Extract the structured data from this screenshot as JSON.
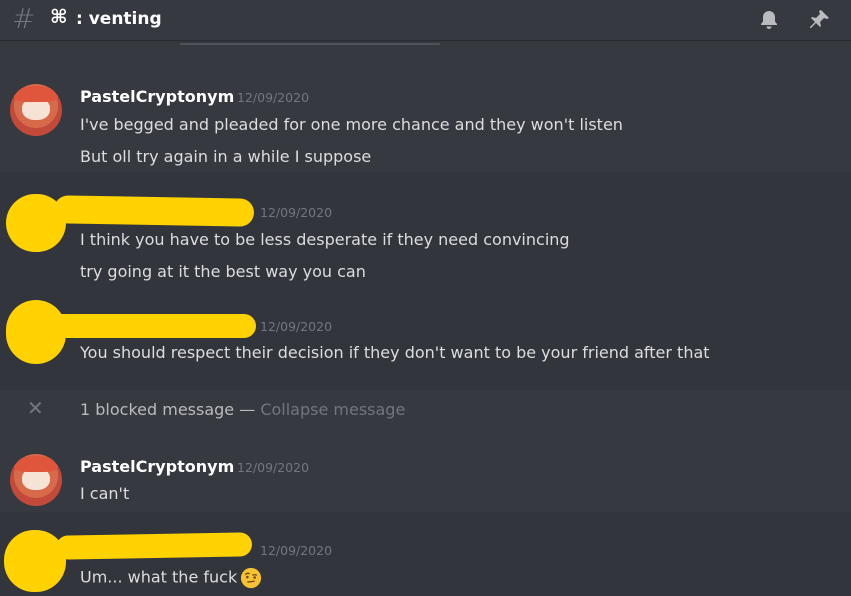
{
  "header": {
    "channel_prefix": "#",
    "channel_emoji": "⌘",
    "channel_name": ": venting",
    "icons": [
      "bell-icon",
      "pin-icon"
    ]
  },
  "messages": [
    {
      "author": "PastelCryptonym",
      "timestamp": "12/09/2020",
      "lines": [
        "I've begged and pleaded for one more chance and they won't listen",
        "But oll try again in a while I suppose"
      ]
    },
    {
      "author": "",
      "timestamp": "12/09/2020",
      "lines": [
        "I think you have to be less desperate if they need convincing",
        "try going at it the best way you can"
      ]
    },
    {
      "author": "",
      "timestamp": "12/09/2020",
      "lines": [
        "You should respect their decision if they don't want to be your friend after that"
      ]
    },
    {
      "author": "PastelCryptonym",
      "timestamp": "12/09/2020",
      "lines": [
        "I can't"
      ]
    },
    {
      "author": "",
      "timestamp": "12/09/2020",
      "lines": [
        "Um... what the fuck"
      ],
      "emoji": "face-with-raised-eyebrow"
    }
  ],
  "blocked": {
    "close_glyph": "✕",
    "text": "1 blocked message",
    "separator": " — ",
    "action": "Collapse message"
  },
  "colors": {
    "background": "#36393f",
    "redaction": "#ffd200",
    "timestamp": "#72767d"
  }
}
